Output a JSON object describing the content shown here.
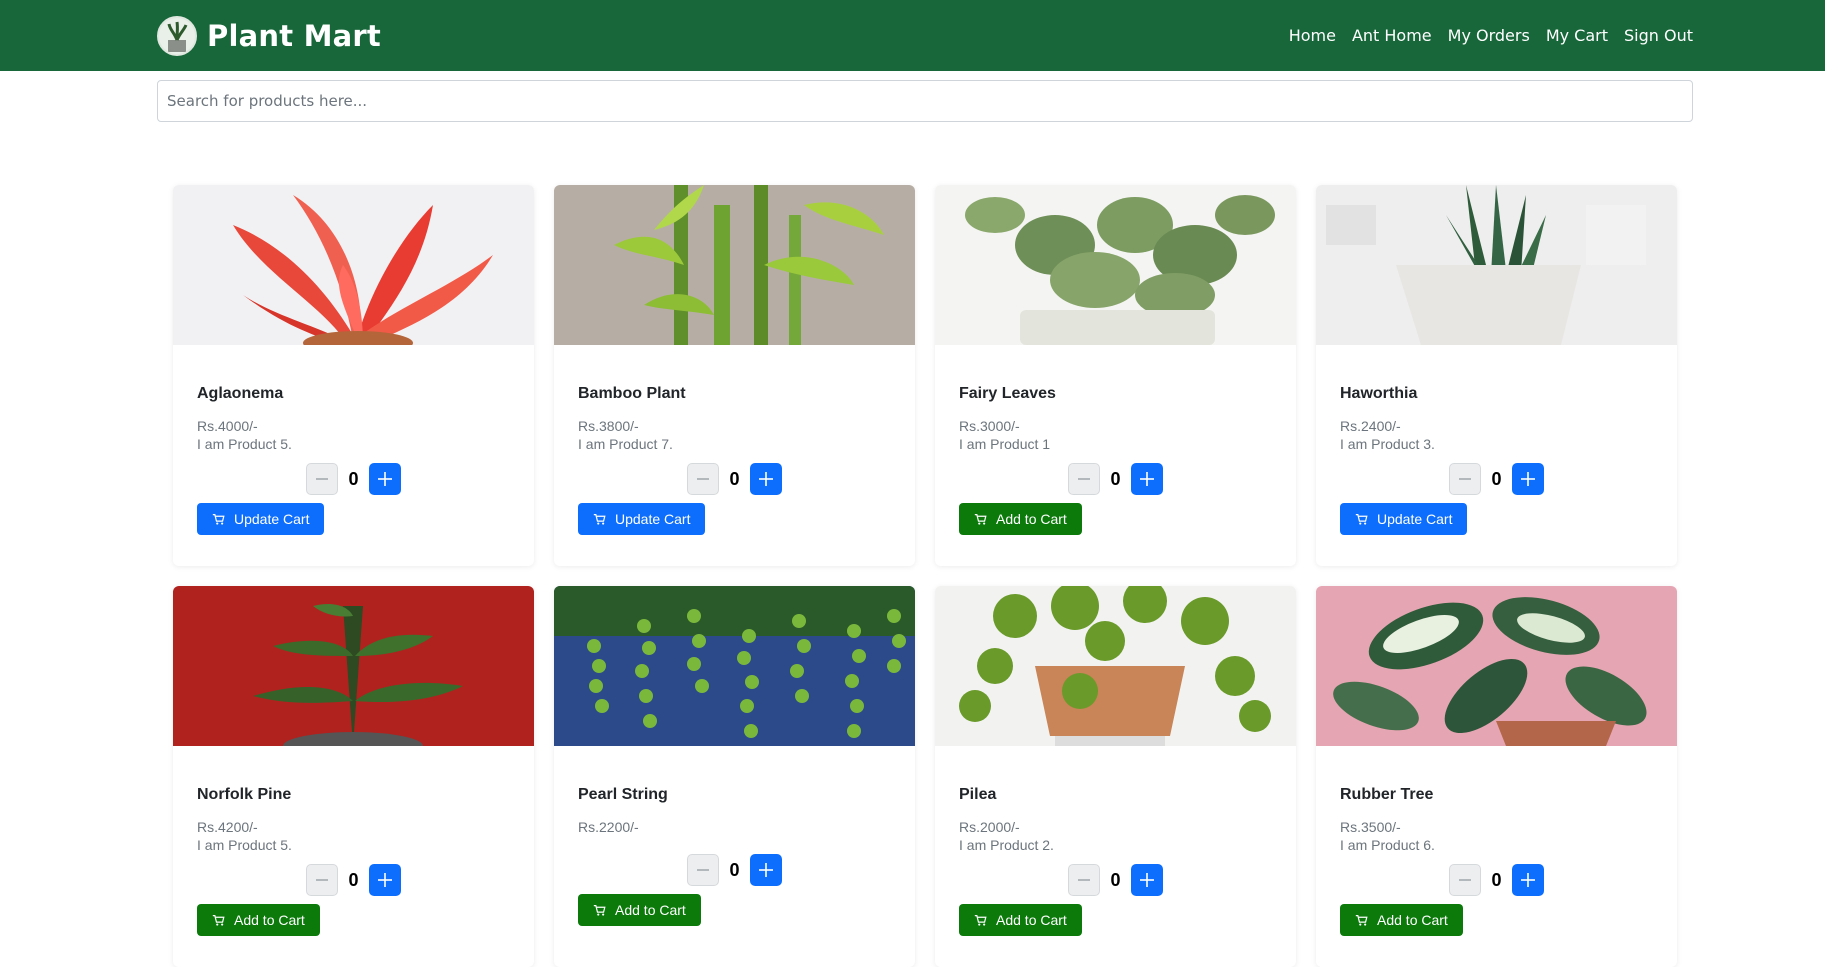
{
  "brand": {
    "name": "Plant Mart",
    "logo_icon": "plant-logo-icon"
  },
  "nav": {
    "home": "Home",
    "ant_home": "Ant Home",
    "my_orders": "My Orders",
    "my_cart": "My Cart",
    "sign_out": "Sign Out"
  },
  "search": {
    "placeholder": "Search for products here...",
    "value": ""
  },
  "colors": {
    "navbar": "#17673a",
    "update_button": "#0d6efd",
    "add_button": "#0b7a0b",
    "plus_button": "#0d6efd"
  },
  "products": [
    {
      "name": "Aglaonema",
      "price": "Rs.4000/-",
      "desc": "I am Product 5.",
      "qty": "0",
      "button": "Update Cart",
      "button_type": "update"
    },
    {
      "name": "Bamboo Plant",
      "price": "Rs.3800/-",
      "desc": "I am Product 7.",
      "qty": "0",
      "button": "Update Cart",
      "button_type": "update"
    },
    {
      "name": "Fairy Leaves",
      "price": "Rs.3000/-",
      "desc": "I am Product 1",
      "qty": "0",
      "button": "Add to Cart",
      "button_type": "add"
    },
    {
      "name": "Haworthia",
      "price": "Rs.2400/-",
      "desc": "I am Product 3.",
      "qty": "0",
      "button": "Update Cart",
      "button_type": "update"
    },
    {
      "name": "Norfolk Pine",
      "price": "Rs.4200/-",
      "desc": "I am Product 5.",
      "qty": "0",
      "button": "Add to Cart",
      "button_type": "add"
    },
    {
      "name": "Pearl String",
      "price": "Rs.2200/-",
      "desc": "",
      "qty": "0",
      "button": "Add to Cart",
      "button_type": "add"
    },
    {
      "name": "Pilea",
      "price": "Rs.2000/-",
      "desc": "I am Product 2.",
      "qty": "0",
      "button": "Add to Cart",
      "button_type": "add"
    },
    {
      "name": "Rubber Tree",
      "price": "Rs.3500/-",
      "desc": "I am Product 6.",
      "qty": "0",
      "button": "Add to Cart",
      "button_type": "add"
    }
  ]
}
